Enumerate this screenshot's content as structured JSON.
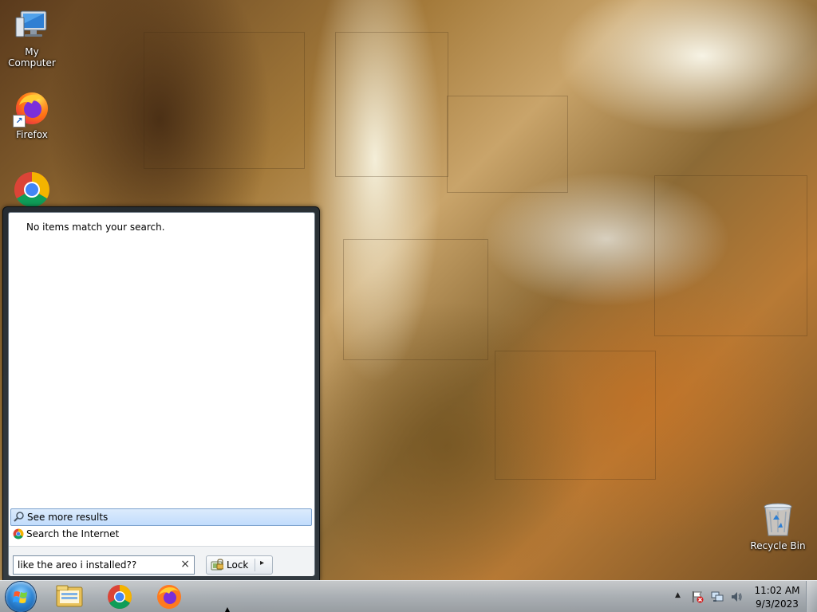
{
  "desktop": {
    "icons": [
      {
        "label": "My Computer",
        "icon": "computer-icon"
      },
      {
        "label": "Firefox",
        "icon": "firefox-icon"
      },
      {
        "label": "",
        "icon": "chrome-icon"
      },
      {
        "label": "Recycle Bin",
        "icon": "recycle-bin-icon"
      }
    ]
  },
  "start_menu": {
    "no_results": "No items match your search.",
    "see_more": "See more results",
    "search_internet": "Search the Internet",
    "search": {
      "value": "like the areo i installed??",
      "clear_glyph": "×"
    },
    "lock": {
      "label": "Lock",
      "arrow": "▸"
    }
  },
  "taskbar": {
    "pinned": [
      "explorer-icon",
      "chrome-icon",
      "firefox-icon"
    ],
    "tray_icons": [
      "show-hidden-icons-arrow",
      "action-center-flag-icon",
      "network-icon",
      "volume-icon"
    ],
    "show_hidden_glyph": "▲",
    "clock": {
      "time": "11:02 AM",
      "date": "9/3/2023"
    }
  },
  "colors": {
    "selection_bg": "#c1dcfc",
    "selection_border": "#7da2ce",
    "taskbar": "#aab2ba",
    "start_menu_frame": "#1e2832"
  }
}
